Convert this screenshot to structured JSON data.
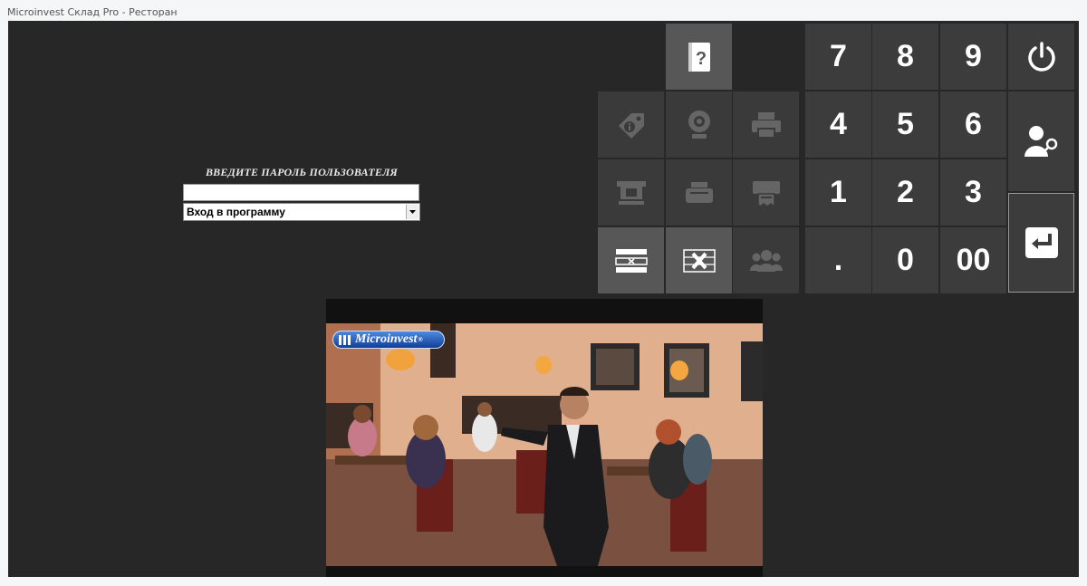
{
  "window": {
    "title": "Microinvest Склад Pro - Ресторан"
  },
  "login": {
    "prompt": "ВВЕДИТЕ ПАРОЛЬ ПОЛЬЗОВАТЕЛЯ",
    "password_value": "",
    "mode_selected": "Вход в программу"
  },
  "function_tiles": [
    {
      "icon": "help-book-icon",
      "state": "active"
    },
    {
      "icon": "tag-info-icon",
      "state": "disabled"
    },
    {
      "icon": "webcam-icon",
      "state": "disabled"
    },
    {
      "icon": "printer-icon",
      "state": "disabled"
    },
    {
      "icon": "cash-register-icon",
      "state": "disabled"
    },
    {
      "icon": "receipt-printer-icon",
      "state": "disabled"
    },
    {
      "icon": "fiscal-printer-icon",
      "state": "disabled"
    },
    {
      "icon": "remove-line-icon",
      "state": "active"
    },
    {
      "icon": "cancel-order-icon",
      "state": "active"
    },
    {
      "icon": "users-group-icon",
      "state": "disabled"
    }
  ],
  "keypad": {
    "keys": [
      "7",
      "8",
      "9",
      "4",
      "5",
      "6",
      "1",
      "2",
      "3",
      ".",
      "0",
      "00"
    ]
  },
  "side_buttons": [
    {
      "icon": "power-icon"
    },
    {
      "icon": "user-key-icon"
    },
    {
      "icon": "enter-icon"
    }
  ],
  "media": {
    "logo_text": "Microinvest",
    "logo_mark": "®"
  },
  "colors": {
    "background": "#272727",
    "tile": "#3a3a3a",
    "tile_active": "#575757",
    "logo_blue": "#1f55b8"
  }
}
